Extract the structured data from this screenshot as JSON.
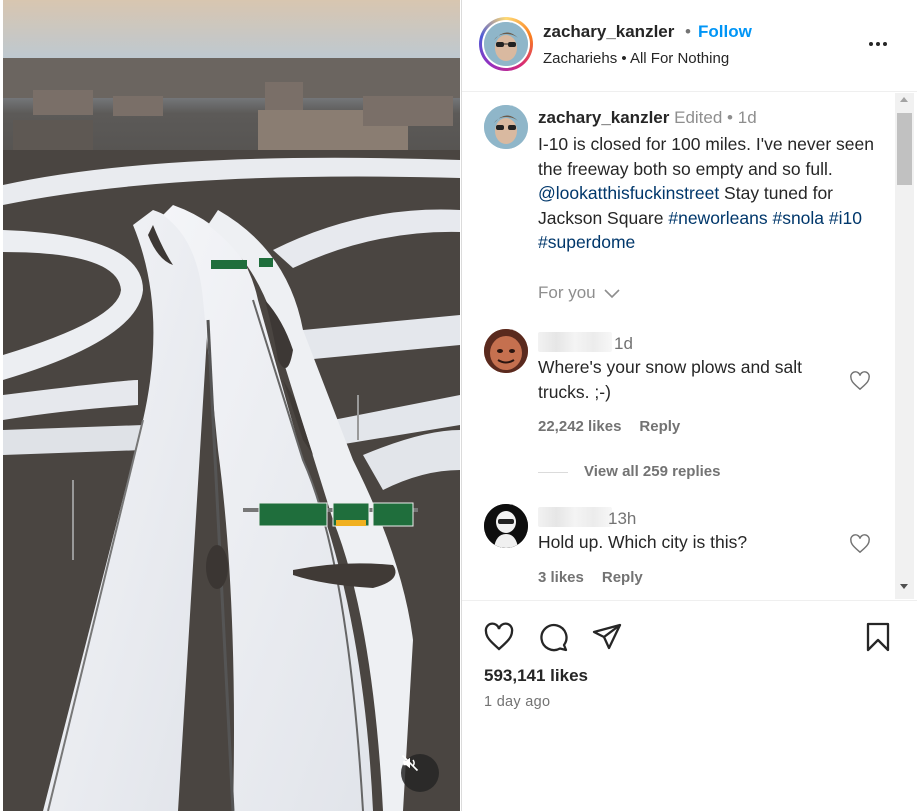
{
  "post": {
    "username": "zachary_kanzler",
    "follow_label": "Follow",
    "separator": "•",
    "subtitle": "Zachariehs • All For Nothing",
    "more_icon": "more-horizontal-icon"
  },
  "media": {
    "mute_icon": "speaker-muted-icon",
    "signs": [
      "West Baton Rouge",
      "East Slidell",
      "East Claiborne Ave"
    ]
  },
  "caption": {
    "username": "zachary_kanzler",
    "edited_label": "Edited",
    "separator": "•",
    "time": "1d",
    "line_prefix": "I-10 is closed for 100 miles. I've never seen the freeway both so empty and so full. ",
    "mention": "@lookatthisfuckinstreet",
    "mid_text": " Stay tuned for Jackson Square ",
    "hashtags": [
      "#neworleans",
      "#snola",
      "#i10",
      "#superdome"
    ],
    "for_you_label": "For you"
  },
  "comments": [
    {
      "time": "1d",
      "text": "Where's your snow plows and salt trucks. ;-)",
      "likes": "22,242 likes",
      "reply_label": "Reply",
      "view_replies": "View all 259 replies"
    },
    {
      "time": "13h",
      "text": "Hold up. Which city is this?",
      "likes": "3 likes",
      "reply_label": "Reply"
    }
  ],
  "footer": {
    "likes": "593,141 likes",
    "time_ago": "1 day ago",
    "icons": [
      "heart-icon",
      "comment-icon",
      "share-icon",
      "bookmark-icon"
    ]
  },
  "colors": {
    "accent": "#0095f6",
    "hashtag": "#00376b",
    "muted": "#737373",
    "text": "#262626"
  }
}
